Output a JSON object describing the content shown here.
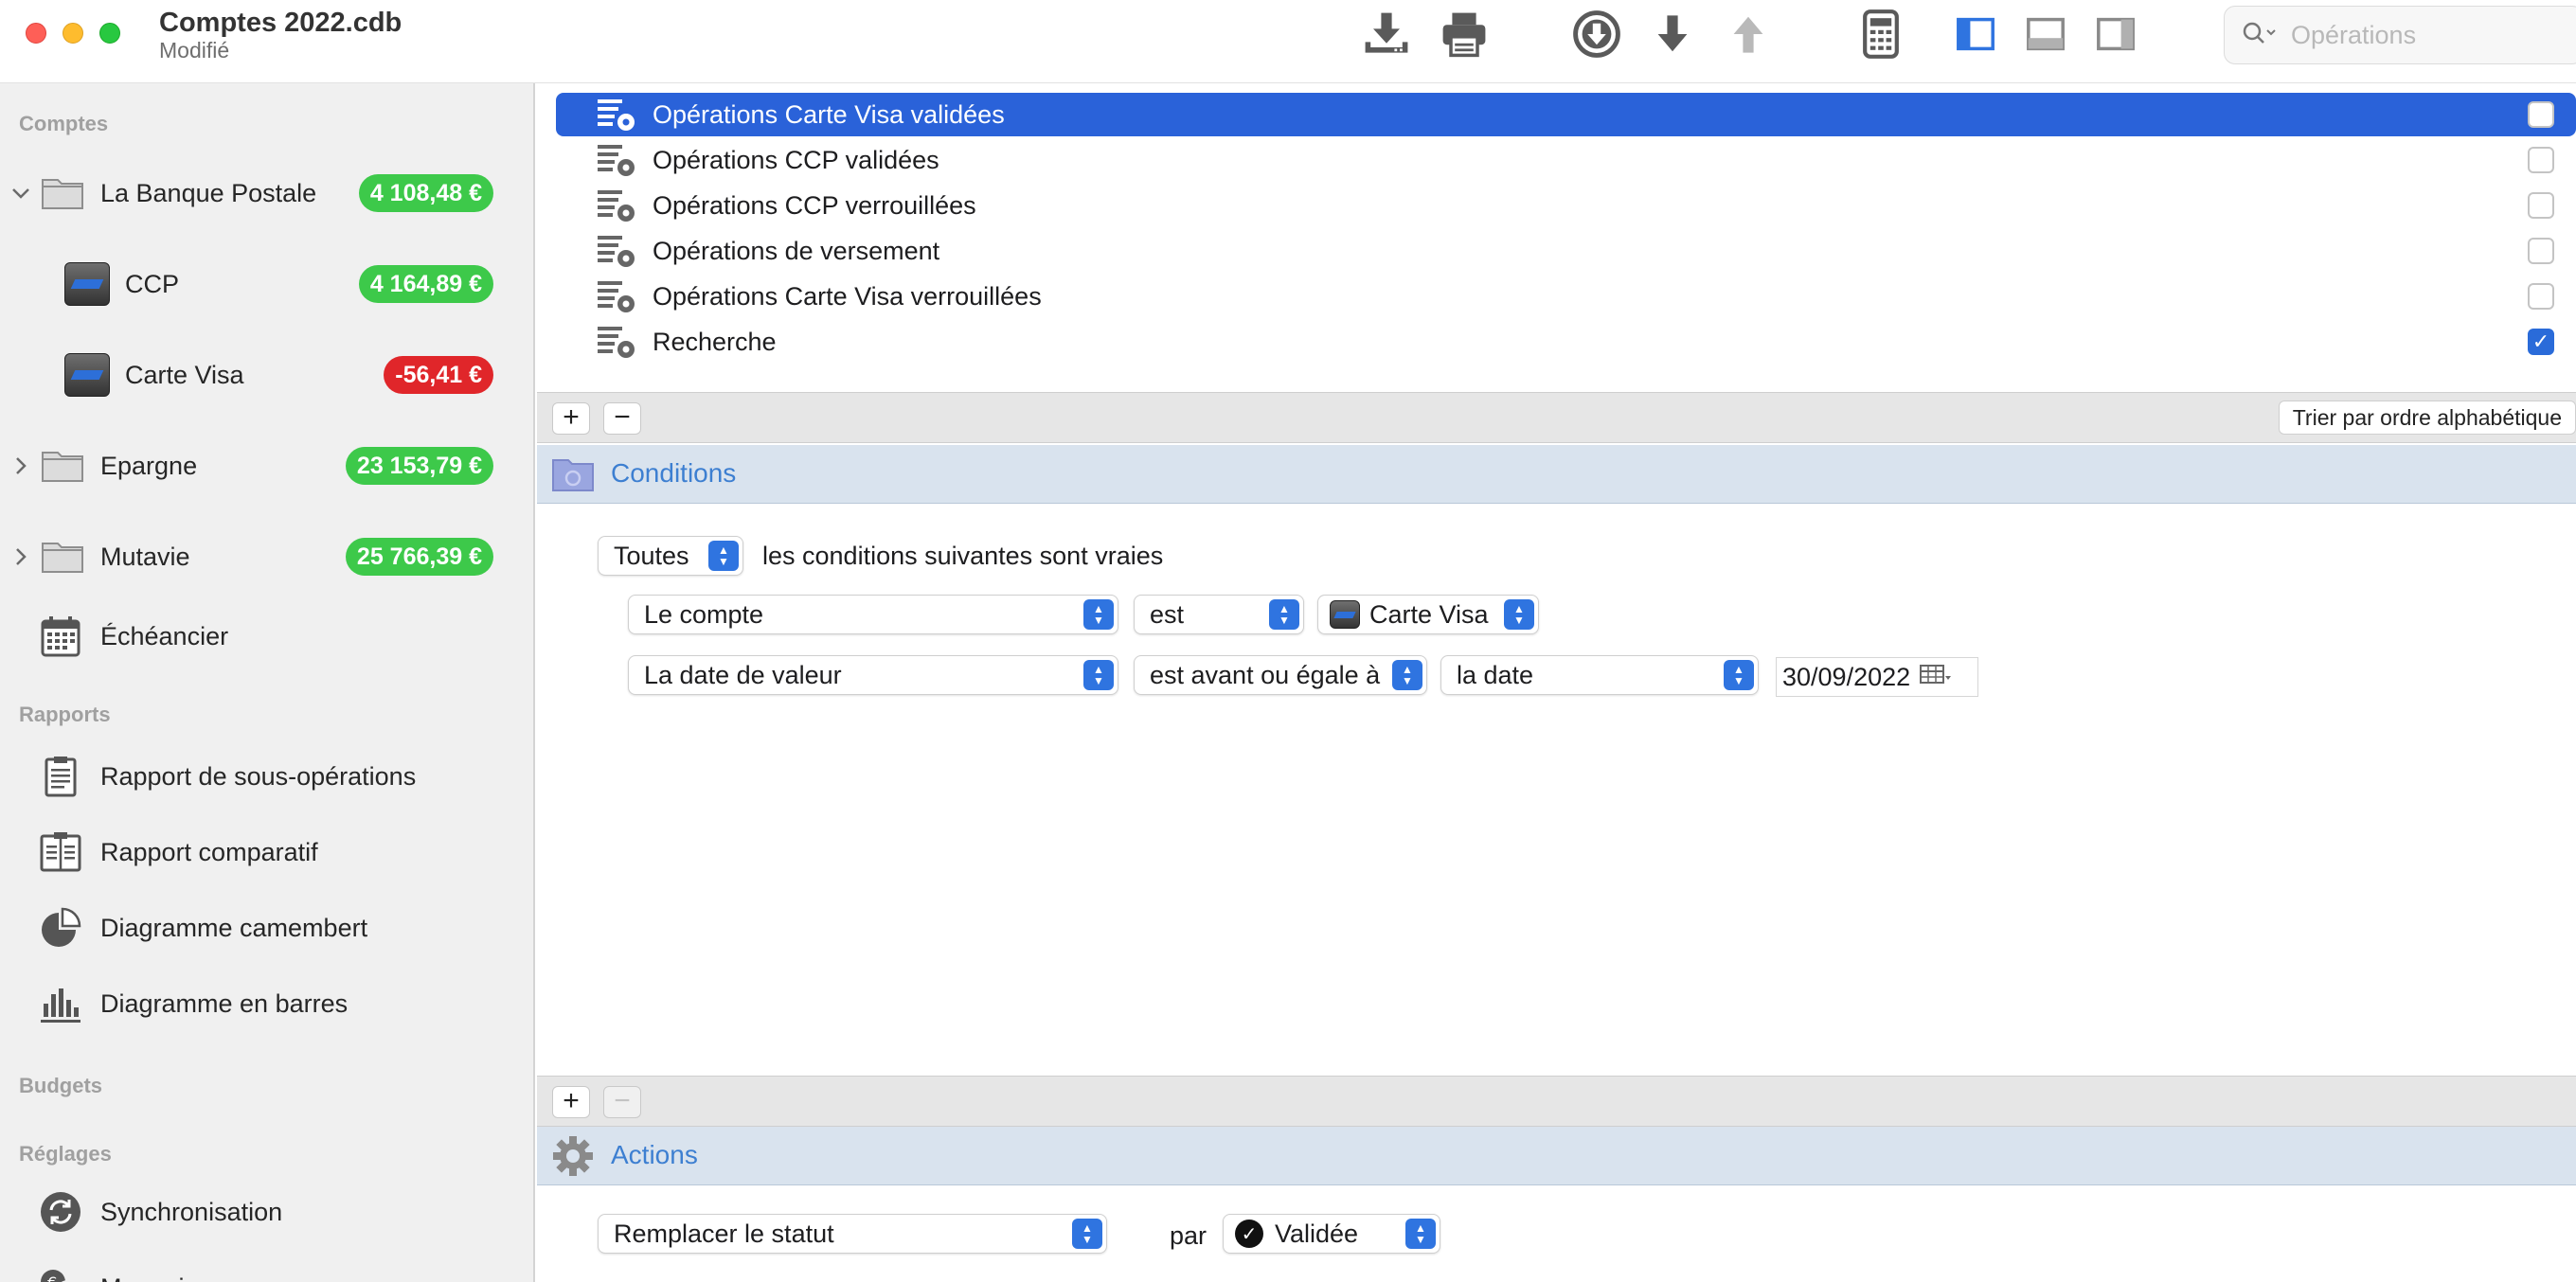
{
  "window": {
    "title": "Comptes 2022.cdb",
    "subtitle": "Modifié"
  },
  "toolbar": {
    "search_placeholder": "Opérations",
    "icons": [
      "download-icon",
      "print-icon",
      "circle-down-icon",
      "arrow-down-icon",
      "arrow-up-icon",
      "calculator-icon",
      "layout-left-icon",
      "layout-bottom-icon",
      "layout-right-icon"
    ]
  },
  "sidebar": {
    "sections": {
      "comptes": "Comptes",
      "rapports": "Rapports",
      "budgets": "Budgets",
      "reglages": "Réglages"
    },
    "accounts": [
      {
        "label": "La Banque Postale",
        "amount": "4 108,48 €",
        "status": "positive"
      },
      {
        "label": "CCP",
        "amount": "4 164,89 €",
        "status": "positive"
      },
      {
        "label": "Carte Visa",
        "amount": "-56,41 €",
        "status": "negative"
      },
      {
        "label": "Epargne",
        "amount": "23 153,79 €",
        "status": "positive"
      },
      {
        "label": "Mutavie",
        "amount": "25 766,39 €",
        "status": "positive"
      }
    ],
    "scheduler": "Échéancier",
    "reports": [
      "Rapport de sous-opérations",
      "Rapport comparatif",
      "Diagramme camembert",
      "Diagramme en barres"
    ],
    "settings": [
      "Synchronisation",
      "Monnaies"
    ]
  },
  "rules": [
    {
      "label": "Opérations Carte Visa validées",
      "checked": false,
      "selected": true
    },
    {
      "label": "Opérations CCP validées",
      "checked": false,
      "selected": false
    },
    {
      "label": "Opérations CCP verrouillées",
      "checked": false,
      "selected": false
    },
    {
      "label": "Opérations de versement",
      "checked": false,
      "selected": false
    },
    {
      "label": "Opérations Carte Visa verrouillées",
      "checked": false,
      "selected": false
    },
    {
      "label": "Recherche",
      "checked": true,
      "selected": false
    }
  ],
  "list_footer": {
    "add": "+",
    "remove": "−",
    "sort_label": "Trier par ordre alphabétique"
  },
  "conditions": {
    "header": "Conditions",
    "match_mode": "Toutes",
    "match_text": "les conditions suivantes sont vraies",
    "rows": [
      {
        "field": "Le compte",
        "operator": "est",
        "value": "Carte Visa"
      },
      {
        "field": "La date de valeur",
        "operator": "est avant ou égale à",
        "value": "la date",
        "date": "30/09/2022"
      }
    ],
    "add": "+",
    "remove": "−"
  },
  "actions": {
    "header": "Actions",
    "action": "Remplacer le statut",
    "by": "par",
    "status": "Validée"
  },
  "colors": {
    "selection": "#2a62d9",
    "badge_positive": "#3dc94a",
    "badge_negative": "#e0262a",
    "section_header_text": "#3d7fd1"
  }
}
